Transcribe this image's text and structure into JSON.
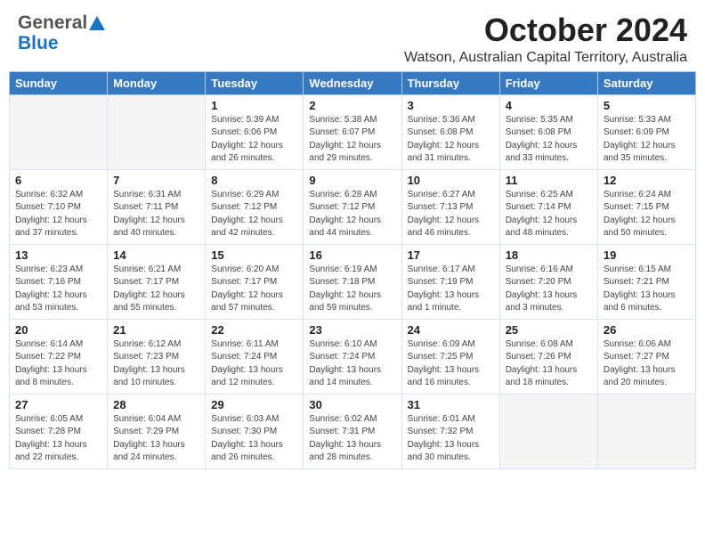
{
  "header": {
    "logo_general": "General",
    "logo_blue": "Blue",
    "month_title": "October 2024",
    "location": "Watson, Australian Capital Territory, Australia"
  },
  "days_of_week": [
    "Sunday",
    "Monday",
    "Tuesday",
    "Wednesday",
    "Thursday",
    "Friday",
    "Saturday"
  ],
  "weeks": [
    [
      {
        "day": "",
        "info": ""
      },
      {
        "day": "",
        "info": ""
      },
      {
        "day": "1",
        "info": "Sunrise: 5:39 AM\nSunset: 6:06 PM\nDaylight: 12 hours\nand 26 minutes."
      },
      {
        "day": "2",
        "info": "Sunrise: 5:38 AM\nSunset: 6:07 PM\nDaylight: 12 hours\nand 29 minutes."
      },
      {
        "day": "3",
        "info": "Sunrise: 5:36 AM\nSunset: 6:08 PM\nDaylight: 12 hours\nand 31 minutes."
      },
      {
        "day": "4",
        "info": "Sunrise: 5:35 AM\nSunset: 6:08 PM\nDaylight: 12 hours\nand 33 minutes."
      },
      {
        "day": "5",
        "info": "Sunrise: 5:33 AM\nSunset: 6:09 PM\nDaylight: 12 hours\nand 35 minutes."
      }
    ],
    [
      {
        "day": "6",
        "info": "Sunrise: 6:32 AM\nSunset: 7:10 PM\nDaylight: 12 hours\nand 37 minutes."
      },
      {
        "day": "7",
        "info": "Sunrise: 6:31 AM\nSunset: 7:11 PM\nDaylight: 12 hours\nand 40 minutes."
      },
      {
        "day": "8",
        "info": "Sunrise: 6:29 AM\nSunset: 7:12 PM\nDaylight: 12 hours\nand 42 minutes."
      },
      {
        "day": "9",
        "info": "Sunrise: 6:28 AM\nSunset: 7:12 PM\nDaylight: 12 hours\nand 44 minutes."
      },
      {
        "day": "10",
        "info": "Sunrise: 6:27 AM\nSunset: 7:13 PM\nDaylight: 12 hours\nand 46 minutes."
      },
      {
        "day": "11",
        "info": "Sunrise: 6:25 AM\nSunset: 7:14 PM\nDaylight: 12 hours\nand 48 minutes."
      },
      {
        "day": "12",
        "info": "Sunrise: 6:24 AM\nSunset: 7:15 PM\nDaylight: 12 hours\nand 50 minutes."
      }
    ],
    [
      {
        "day": "13",
        "info": "Sunrise: 6:23 AM\nSunset: 7:16 PM\nDaylight: 12 hours\nand 53 minutes."
      },
      {
        "day": "14",
        "info": "Sunrise: 6:21 AM\nSunset: 7:17 PM\nDaylight: 12 hours\nand 55 minutes."
      },
      {
        "day": "15",
        "info": "Sunrise: 6:20 AM\nSunset: 7:17 PM\nDaylight: 12 hours\nand 57 minutes."
      },
      {
        "day": "16",
        "info": "Sunrise: 6:19 AM\nSunset: 7:18 PM\nDaylight: 12 hours\nand 59 minutes."
      },
      {
        "day": "17",
        "info": "Sunrise: 6:17 AM\nSunset: 7:19 PM\nDaylight: 13 hours\nand 1 minute."
      },
      {
        "day": "18",
        "info": "Sunrise: 6:16 AM\nSunset: 7:20 PM\nDaylight: 13 hours\nand 3 minutes."
      },
      {
        "day": "19",
        "info": "Sunrise: 6:15 AM\nSunset: 7:21 PM\nDaylight: 13 hours\nand 6 minutes."
      }
    ],
    [
      {
        "day": "20",
        "info": "Sunrise: 6:14 AM\nSunset: 7:22 PM\nDaylight: 13 hours\nand 8 minutes."
      },
      {
        "day": "21",
        "info": "Sunrise: 6:12 AM\nSunset: 7:23 PM\nDaylight: 13 hours\nand 10 minutes."
      },
      {
        "day": "22",
        "info": "Sunrise: 6:11 AM\nSunset: 7:24 PM\nDaylight: 13 hours\nand 12 minutes."
      },
      {
        "day": "23",
        "info": "Sunrise: 6:10 AM\nSunset: 7:24 PM\nDaylight: 13 hours\nand 14 minutes."
      },
      {
        "day": "24",
        "info": "Sunrise: 6:09 AM\nSunset: 7:25 PM\nDaylight: 13 hours\nand 16 minutes."
      },
      {
        "day": "25",
        "info": "Sunrise: 6:08 AM\nSunset: 7:26 PM\nDaylight: 13 hours\nand 18 minutes."
      },
      {
        "day": "26",
        "info": "Sunrise: 6:06 AM\nSunset: 7:27 PM\nDaylight: 13 hours\nand 20 minutes."
      }
    ],
    [
      {
        "day": "27",
        "info": "Sunrise: 6:05 AM\nSunset: 7:28 PM\nDaylight: 13 hours\nand 22 minutes."
      },
      {
        "day": "28",
        "info": "Sunrise: 6:04 AM\nSunset: 7:29 PM\nDaylight: 13 hours\nand 24 minutes."
      },
      {
        "day": "29",
        "info": "Sunrise: 6:03 AM\nSunset: 7:30 PM\nDaylight: 13 hours\nand 26 minutes."
      },
      {
        "day": "30",
        "info": "Sunrise: 6:02 AM\nSunset: 7:31 PM\nDaylight: 13 hours\nand 28 minutes."
      },
      {
        "day": "31",
        "info": "Sunrise: 6:01 AM\nSunset: 7:32 PM\nDaylight: 13 hours\nand 30 minutes."
      },
      {
        "day": "",
        "info": ""
      },
      {
        "day": "",
        "info": ""
      }
    ]
  ]
}
